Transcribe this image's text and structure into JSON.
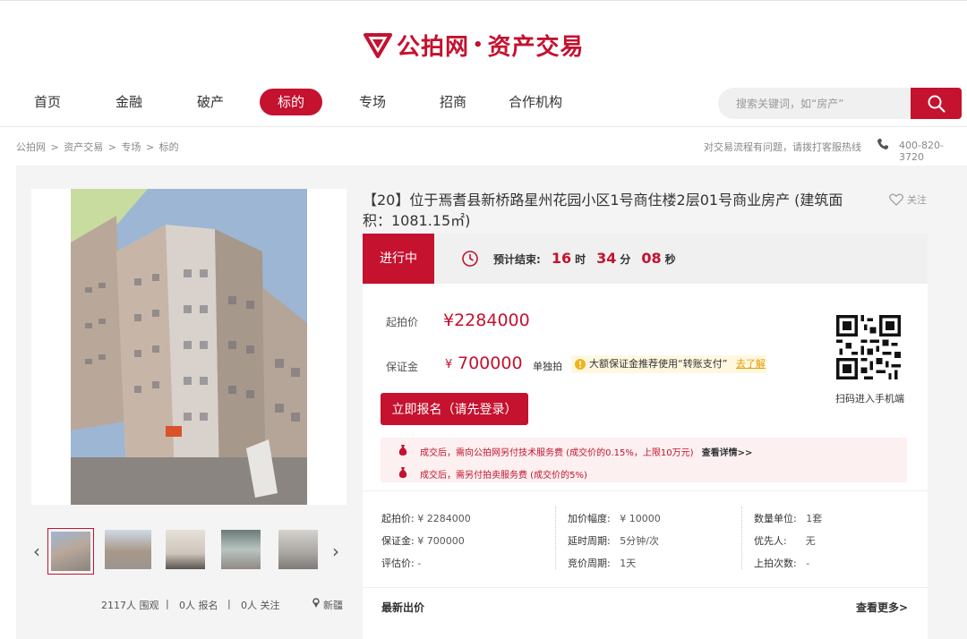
{
  "brand": {
    "name": "公拍网",
    "dot": "•",
    "section": "资产交易",
    "accent": "#c4122f"
  },
  "nav": {
    "items": [
      "首页",
      "金融",
      "破产",
      "标的",
      "专场",
      "招商",
      "合作机构"
    ],
    "active_index": 3
  },
  "search": {
    "placeholder": "搜索关键词，如“房产”"
  },
  "breadcrumb": [
    "公拍网",
    ">",
    "资产交易",
    ">",
    "专场",
    ">",
    "标的"
  ],
  "help": {
    "text": "对交易流程有问题，请拨打客服热线",
    "phone": "400-820-3720"
  },
  "listing": {
    "title": "【20】位于焉耆县新桥路星州花园小区1号商住楼2层01号商业房产 (建筑面积：1081.15㎡)",
    "follow_label": "关注",
    "status": "进行中",
    "countdown": {
      "label": "预计结束:",
      "hours": "16",
      "hours_unit": "时",
      "minutes": "34",
      "minutes_unit": "分",
      "seconds": "08",
      "seconds_unit": "秒"
    },
    "start_price_label": "起拍价",
    "start_price": "¥2284000",
    "deposit_label": "保证金",
    "deposit_symbol": "¥",
    "deposit": "700000",
    "auction_type": "单独拍",
    "deposit_tip": "大额保证金推荐使用“转账支付”",
    "deposit_tip_link": "去了解",
    "signup_button": "立即报名（请先登录）",
    "qr_label": "扫码进入手机端",
    "fees": [
      {
        "text": "成交后，需向公拍网另付技术服务费 (成交价的0.15%，上限10万元)",
        "link": "查看详情>>"
      },
      {
        "text": "成交后，需另付拍卖服务费 (成交价的5%)",
        "link": ""
      }
    ]
  },
  "details": {
    "col1": [
      {
        "label": "起拍价:",
        "value": "¥ 2284000"
      },
      {
        "label": "保证金:",
        "value": "¥ 700000"
      },
      {
        "label": "评估价:",
        "value": "-"
      }
    ],
    "col2": [
      {
        "label": "加价幅度:",
        "value": "¥ 10000"
      },
      {
        "label": "延时周期:",
        "value": "5分钟/次"
      },
      {
        "label": "竞价周期:",
        "value": "1天"
      }
    ],
    "col3": [
      {
        "label": "数量单位:",
        "value": "1套"
      },
      {
        "label": "优先人:",
        "value": "无"
      },
      {
        "label": "上拍次数:",
        "value": "-"
      }
    ]
  },
  "latest_bids": {
    "title": "最新出价",
    "more": "查看更多>"
  },
  "stats": {
    "views": "2117人 围观",
    "sep": "|",
    "signups": "0人 报名",
    "follows": "0人 关注",
    "location": "新疆"
  }
}
